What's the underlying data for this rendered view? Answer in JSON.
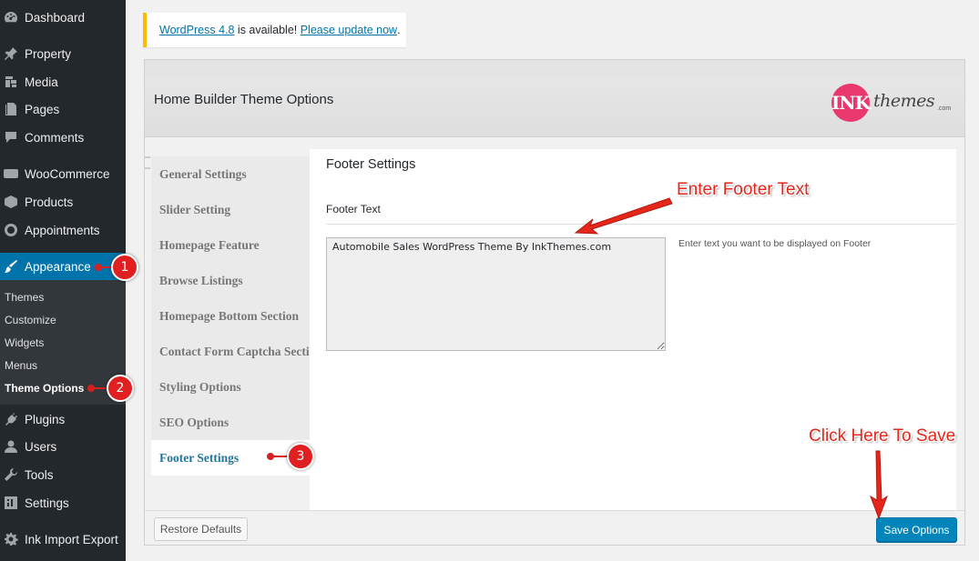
{
  "sidebar": {
    "items": [
      {
        "label": "Dashboard",
        "icon": "dashboard-icon"
      },
      {
        "label": "Property",
        "icon": "pin-icon"
      },
      {
        "label": "Media",
        "icon": "media-icon"
      },
      {
        "label": "Pages",
        "icon": "pages-icon"
      },
      {
        "label": "Comments",
        "icon": "comments-icon"
      },
      {
        "label": "WooCommerce",
        "icon": "woocommerce-icon"
      },
      {
        "label": "Products",
        "icon": "products-icon"
      },
      {
        "label": "Appointments",
        "icon": "appointments-icon"
      },
      {
        "label": "Appearance",
        "icon": "appearance-icon"
      },
      {
        "label": "Plugins",
        "icon": "plugins-icon"
      },
      {
        "label": "Users",
        "icon": "users-icon"
      },
      {
        "label": "Tools",
        "icon": "tools-icon"
      },
      {
        "label": "Settings",
        "icon": "settings-icon"
      },
      {
        "label": "Ink Import Export",
        "icon": "gear-icon"
      }
    ],
    "submenu": [
      "Themes",
      "Customize",
      "Widgets",
      "Menus",
      "Theme Options"
    ],
    "woo_badge": "Woo"
  },
  "notice": {
    "version_link": "WordPress 4.8",
    "middle": " is available! ",
    "update_link": "Please update now",
    "end": "."
  },
  "panel": {
    "title": "Home Builder Theme Options",
    "logo": {
      "circle": "INK",
      "text": "themes",
      "suffix": ".com"
    },
    "tabs": [
      "General Settings",
      "Slider Setting",
      "Homepage Feature",
      "Browse Listings",
      "Homepage Bottom Section",
      "Contact Form Captcha Section",
      "Styling Options",
      "SEO Options",
      "Footer Settings"
    ],
    "section_title": "Footer Settings",
    "field_label": "Footer Text",
    "field_value": "Automobile Sales WordPress Theme By InkThemes.com",
    "help_text": "Enter text you want to be displayed on Footer",
    "restore_label": "Restore Defaults",
    "save_label": "Save Options"
  },
  "annotations": {
    "steps": [
      "1",
      "2",
      "3"
    ],
    "enter_footer": "Enter Footer Text",
    "click_save": "Click Here To Save",
    "color": "#e5261b"
  }
}
